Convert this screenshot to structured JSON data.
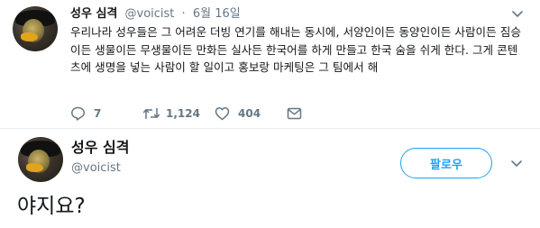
{
  "parent_tweet": {
    "author_name": "성우 심격",
    "handle": "@voicist",
    "separator": "·",
    "date": "6월 16일",
    "text": "우리나라 성우들은 그 어려운 더빙 연기를 해내는 동시에, 서양인이든 동양인이든 사람이든 짐승이든 생물이든 무생물이든 만화든 실사든 한국어를 하게 만들고 한국 숨을 쉬게 한다. 그게 콘텐츠에 생명을 넣는 사람이 할 일이고 홍보랑 마케팅은 그 팀에서 해",
    "reply_count": "7",
    "retweet_count": "1,124",
    "like_count": "404",
    "icons": [
      "reply-icon",
      "retweet-icon",
      "like-icon",
      "direct-message-icon",
      "chevron-down-icon"
    ]
  },
  "main_tweet": {
    "author_name": "성우 심격",
    "handle": "@voicist",
    "follow_label": "팔로우",
    "text": "야지요?"
  },
  "colors": {
    "accent": "#1da1f2",
    "text": "#14171a",
    "muted": "#657786",
    "divider": "#e6ecf0"
  }
}
